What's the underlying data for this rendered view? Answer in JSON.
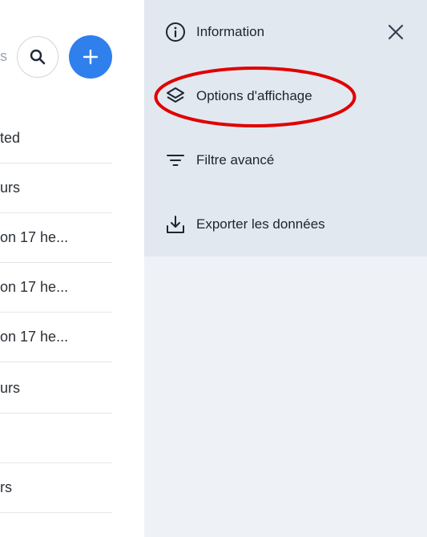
{
  "left": {
    "search_hint": "s",
    "rows": [
      {
        "text": "ted"
      },
      {
        "text": "urs"
      },
      {
        "text": "on 17 he..."
      },
      {
        "text": "on 17 he..."
      },
      {
        "text": "on 17 he..."
      },
      {
        "text": "urs"
      },
      {
        "text": ""
      },
      {
        "text": "rs"
      }
    ]
  },
  "panel": {
    "items": [
      {
        "label": "Information",
        "icon": "info-icon"
      },
      {
        "label": "Options d'affichage",
        "icon": "layers-icon"
      },
      {
        "label": "Filtre avancé",
        "icon": "filter-icon"
      },
      {
        "label": "Exporter les données",
        "icon": "download-icon"
      }
    ],
    "close_icon": "close-icon"
  },
  "colors": {
    "accent": "#2f80ed",
    "menu_bg": "#e2e8f0",
    "panel_bg": "#eef1f6",
    "annotation": "#e00000"
  }
}
